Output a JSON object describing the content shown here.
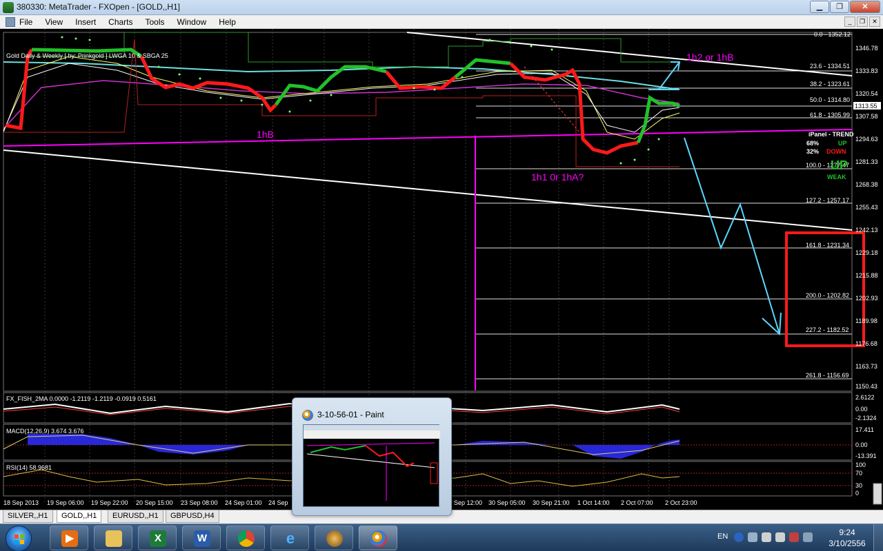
{
  "window": {
    "title": "380330: MetaTrader - FXOpen - [GOLD,,H1]",
    "minimize_icon": "minimize-icon",
    "maximize_icon": "maximize-icon",
    "close_icon": "close-icon"
  },
  "menu": [
    "File",
    "View",
    "Insert",
    "Charts",
    "Tools",
    "Window",
    "Help"
  ],
  "chart": {
    "info_label": "Gold Daily & Weekly [ by: Prinkgold ] LWGA 10 & SBGA 25",
    "current_price": "1313.55",
    "price_axis": [
      "1346.78",
      "1333.83",
      "1320.54",
      "1307.58",
      "1294.63",
      "1281.33",
      "1268.38",
      "1255.43",
      "1242.13",
      "1229.18",
      "1215.88",
      "1202.93",
      "1189.98",
      "1176.68",
      "1163.73",
      "1150.43"
    ],
    "fib_levels": [
      {
        "label": "0.0 - 1352.12"
      },
      {
        "label": "23.6 - 1334.51"
      },
      {
        "label": "38.2 - 1323.61"
      },
      {
        "label": "50.0 - 1314.80"
      },
      {
        "label": "61.8 - 1305.99"
      },
      {
        "label": "100.0 - 1277.47"
      },
      {
        "label": "127.2 - 1257.17"
      },
      {
        "label": "161.8 - 1231.34"
      },
      {
        "label": "200.0 - 1202.82"
      },
      {
        "label": "227.2 - 1182.52"
      },
      {
        "label": "261.8 - 1156.69"
      }
    ],
    "annotations": {
      "wave_1hb": "1hB",
      "wave_1h2": "1h2 or 1hB",
      "wave_1h1": "1h1 0r 1hA?"
    },
    "ipanel": {
      "title": "iPanel - TREND",
      "pct_up": "68%",
      "pct_down": "32%",
      "up_label": "UP",
      "down_label": "DOWN",
      "big_up": "UP",
      "weak": "WEAK"
    },
    "time_axis": [
      "18 Sep 2013",
      "19 Sep 06:00",
      "19 Sep 22:00",
      "20 Sep 15:00",
      "23 Sep 08:00",
      "24 Sep 01:00",
      "24 Sep",
      "Sep 12:00",
      "30 Sep 05:00",
      "30 Sep 21:00",
      "1 Oct 14:00",
      "2 Oct 07:00",
      "2 Oct 23:00"
    ],
    "colors": {
      "up": "#22c02a",
      "down": "#ff1a1a",
      "magenta": "#ff00ff",
      "cyan": "#5fd7ff",
      "white": "#ffffff"
    }
  },
  "indicators": {
    "fisher": {
      "label": "FX_FISH_2MA 0.0000 -1.2119 -1.2119 -0.0919 0.5161",
      "axis": [
        "2.6122",
        "0.00",
        "-2.1324"
      ]
    },
    "macd": {
      "label": "MACD(12,26,9) 3.674 3.676",
      "axis": [
        "17.411",
        "0.00",
        "-13.391"
      ]
    },
    "rsi": {
      "label": "RSI(14) 58.9681",
      "axis": [
        "100",
        "70",
        "30",
        "0"
      ]
    }
  },
  "tabs": [
    "SILVER,,H1",
    "GOLD,,H1",
    "EURUSD,,H1",
    "GBPUSD,H4"
  ],
  "preview": {
    "title": "3-10-56-01 - Paint",
    "icon": "paint-icon"
  },
  "taskbar": {
    "apps": [
      {
        "name": "media-player-icon"
      },
      {
        "name": "file-explorer-icon"
      },
      {
        "name": "excel-icon",
        "glyph": "X"
      },
      {
        "name": "word-icon",
        "glyph": "W"
      },
      {
        "name": "chrome-icon"
      },
      {
        "name": "internet-explorer-icon",
        "glyph": "e"
      },
      {
        "name": "metatrader-icon"
      },
      {
        "name": "paint-icon"
      }
    ],
    "lang": "EN",
    "time": "9:24",
    "date": "3/10/2556"
  }
}
